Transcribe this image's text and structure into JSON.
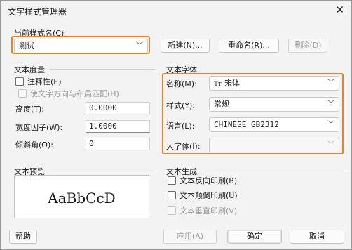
{
  "window": {
    "title": "文字样式管理器",
    "close_glyph": "✕"
  },
  "current_style": {
    "label": "当前样式名(C)",
    "value": "测试",
    "new_button": "新建(N)...",
    "rename_button": "重命名(R)...",
    "delete_button": "删除(D)"
  },
  "text_measure": {
    "group_label": "文本度量",
    "annotative_label": "注释性(E)",
    "match_layout_label": "使文字方向与布局匹配(H)",
    "height_label": "高度(T):",
    "height_value": "0.0000",
    "width_factor_label": "宽度因子(W):",
    "width_factor_value": "1.0000",
    "oblique_label": "倾斜角(O):",
    "oblique_value": "0"
  },
  "text_font": {
    "group_label": "文本字体",
    "name_label": "名称(M):",
    "name_icon": "Tт",
    "name_value": "宋体",
    "style_label": "样式(Y):",
    "style_value": "常规",
    "language_label": "语言(L):",
    "language_value": "CHINESE_GB2312",
    "big_font_label": "大字体(I):",
    "big_font_value": ""
  },
  "preview": {
    "group_label": "文本预览",
    "sample_text": "AaBbCcD"
  },
  "text_generation": {
    "group_label": "文本生成",
    "backwards_label": "文本反向印刷(B)",
    "upside_down_label": "文本颠倒印刷(U)",
    "vertical_label": "文本垂直印刷(V)"
  },
  "footer": {
    "help_button": "帮助",
    "apply_button": "应用(A)",
    "ok_button": "确定",
    "cancel_button": "取消"
  },
  "colors": {
    "highlight": "#e5852a",
    "background": "#f3f3f3"
  }
}
